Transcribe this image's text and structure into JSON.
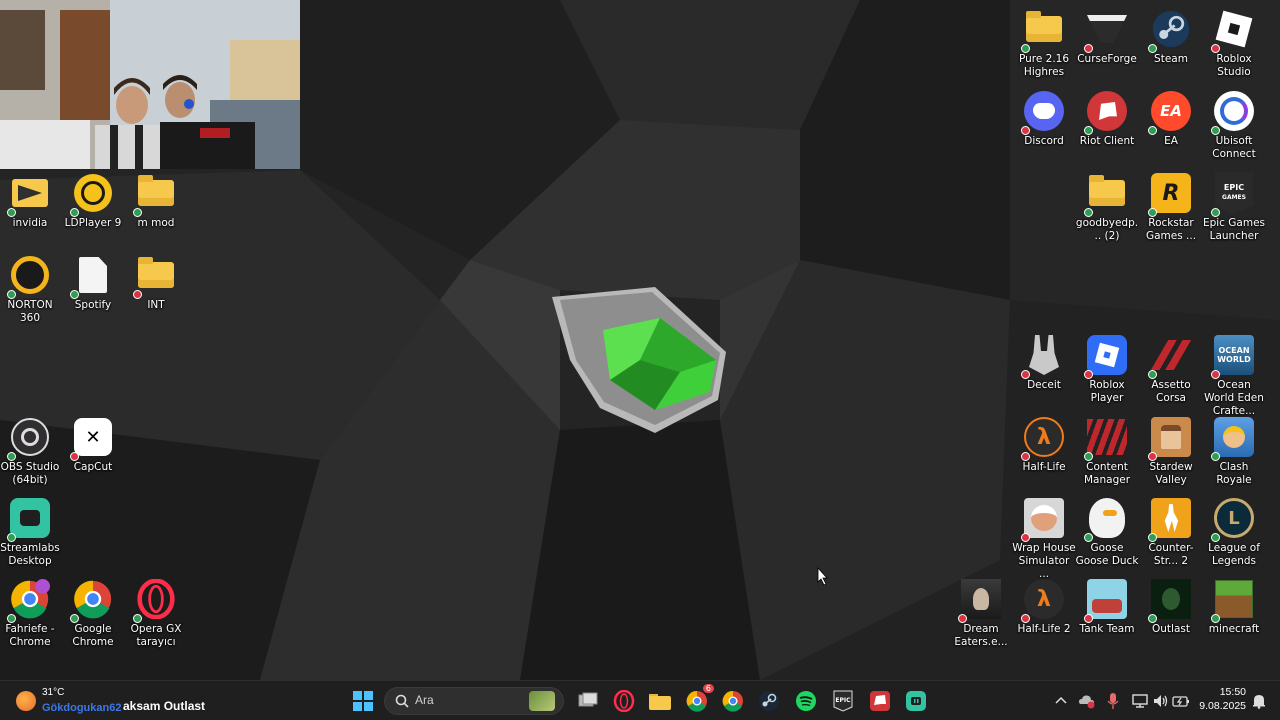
{
  "desktop": {
    "left_icons": [
      {
        "label": "invidia",
        "icon": "nvidia-icon",
        "status": "ok"
      },
      {
        "label": "LDPlayer 9",
        "icon": "ldplayer-icon",
        "status": "ok"
      },
      {
        "label": "m mod",
        "icon": "folder-icon",
        "status": "ok"
      },
      {
        "label": "NORTON 360",
        "icon": "norton-icon",
        "status": "ok"
      },
      {
        "label": "Spotify",
        "icon": "file-icon",
        "status": "ok"
      },
      {
        "label": "INT",
        "icon": "folder-icon",
        "status": "err"
      },
      {
        "label": "OBS Studio (64bit)",
        "icon": "obs-icon",
        "status": "ok"
      },
      {
        "label": "CapCut",
        "icon": "capcut-icon",
        "status": "err"
      },
      {
        "label": "Streamlabs Desktop",
        "icon": "streamlabs-icon",
        "status": "ok"
      },
      {
        "label": "Fahriefe - Chrome",
        "icon": "chrome-profile-icon",
        "status": "ok"
      },
      {
        "label": "Google Chrome",
        "icon": "chrome-icon",
        "status": "ok"
      },
      {
        "label": "Opera GX tarayıcı",
        "icon": "opera-gx-icon",
        "status": "ok"
      }
    ],
    "right_icons": [
      {
        "label": "Pure 2.16 Highres",
        "icon": "folder-icon",
        "status": "ok"
      },
      {
        "label": "CurseForge",
        "icon": "curseforge-icon",
        "status": "err"
      },
      {
        "label": "Steam",
        "icon": "steam-icon",
        "status": "ok"
      },
      {
        "label": "Roblox Studio",
        "icon": "roblox-studio-icon",
        "status": "err"
      },
      {
        "label": "Discord",
        "icon": "discord-icon",
        "status": "err"
      },
      {
        "label": "Riot Client",
        "icon": "riot-icon",
        "status": "ok"
      },
      {
        "label": "EA",
        "icon": "ea-icon",
        "status": "ok"
      },
      {
        "label": "Ubisoft Connect",
        "icon": "ubisoft-icon",
        "status": "ok"
      },
      {
        "label": "goodbyedp... (2)",
        "icon": "folder-icon",
        "status": "ok"
      },
      {
        "label": "Rockstar Games ...",
        "icon": "rockstar-icon",
        "status": "ok"
      },
      {
        "label": "Epic Games Launcher",
        "icon": "epic-games-icon",
        "status": "ok"
      },
      {
        "label": "Deceit",
        "icon": "deceit-icon",
        "status": "err"
      },
      {
        "label": "Roblox Player",
        "icon": "roblox-icon",
        "status": "err"
      },
      {
        "label": "Assetto Corsa",
        "icon": "assetto-corsa-icon",
        "status": "ok"
      },
      {
        "label": "Ocean World Eden Crafte...",
        "icon": "ocean-world-icon",
        "status": "err"
      },
      {
        "label": "Half-Life",
        "icon": "half-life-icon",
        "status": "err"
      },
      {
        "label": "Content Manager",
        "icon": "content-manager-icon",
        "status": "ok"
      },
      {
        "label": "Stardew Valley",
        "icon": "stardew-icon",
        "status": "err"
      },
      {
        "label": "Clash Royale",
        "icon": "clash-royale-icon",
        "status": "ok"
      },
      {
        "label": "Wrap House Simulator ...",
        "icon": "wrap-house-icon",
        "status": "err"
      },
      {
        "label": "Goose Goose Duck",
        "icon": "goose-goose-duck-icon",
        "status": "ok"
      },
      {
        "label": "Counter-Str... 2",
        "icon": "counter-strike-icon",
        "status": "ok"
      },
      {
        "label": "League of Legends",
        "icon": "league-icon",
        "status": "ok"
      },
      {
        "label": "Dream Eaters.e...",
        "icon": "dream-eaters-icon",
        "status": "err"
      },
      {
        "label": "Half-Life 2",
        "icon": "half-life-2-icon",
        "status": "err"
      },
      {
        "label": "Tank Team",
        "icon": "tank-team-icon",
        "status": "err"
      },
      {
        "label": "Outlast",
        "icon": "outlast-icon",
        "status": "ok"
      },
      {
        "label": "minecraft",
        "icon": "minecraft-icon",
        "status": "ok"
      }
    ]
  },
  "taskbar": {
    "weather": {
      "temp": "31°C",
      "overlay_text": "Gökdogukan62",
      "icon": "weather-sun-icon"
    },
    "now_playing": "aksam Outlast",
    "search_placeholder": "Ara",
    "pinned": [
      {
        "name": "start-button",
        "icon": "windows-icon"
      },
      {
        "name": "search-box",
        "icon": "search-icon"
      },
      {
        "name": "task-view",
        "icon": "task-view-icon"
      },
      {
        "name": "opera-gx",
        "icon": "opera-gx-icon"
      },
      {
        "name": "file-explorer",
        "icon": "folder-icon"
      },
      {
        "name": "chrome-profile",
        "icon": "chrome-icon",
        "badge": "6"
      },
      {
        "name": "chrome",
        "icon": "chrome-icon"
      },
      {
        "name": "steam",
        "icon": "steam-icon"
      },
      {
        "name": "spotify",
        "icon": "spotify-icon"
      },
      {
        "name": "epic-games",
        "icon": "epic-games-icon"
      },
      {
        "name": "riot-client",
        "icon": "riot-icon"
      },
      {
        "name": "streamlabs",
        "icon": "streamlabs-icon"
      }
    ],
    "clock": {
      "time": "15:50",
      "date": "9.08.2025"
    }
  },
  "colors": {
    "taskbar_bg": "#1f1f1f",
    "wallpaper_dark": "#1e1e1e",
    "logo_green": "#35c13c",
    "badge_ok": "#2e9e52",
    "badge_err": "#d93545"
  }
}
